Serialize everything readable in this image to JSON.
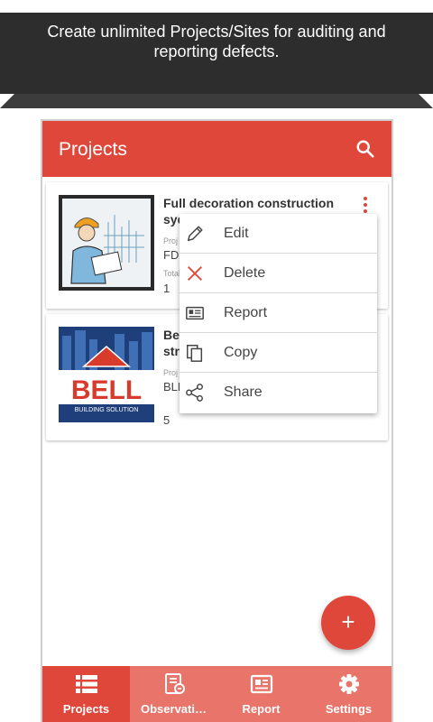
{
  "banner": {
    "text": "Create unlimited Projects/Sites for auditing and reporting defects."
  },
  "appbar": {
    "title": "Projects",
    "search_icon": "search-icon"
  },
  "projects": [
    {
      "title": "Full decoration construction sydney location",
      "label_code": "Proj",
      "code": "FDC",
      "label_total": "Total",
      "count": "1"
    },
    {
      "title": "Bell",
      "title_line2": "stre",
      "label_code": "Proj",
      "code": "BLL",
      "label_total": "",
      "count": "5",
      "logo_text": "BELL",
      "logo_sub": "BUILDING SOLUTION"
    }
  ],
  "popup_menu": [
    {
      "label": "Edit",
      "icon": "pencil-icon"
    },
    {
      "label": "Delete",
      "icon": "close-icon"
    },
    {
      "label": "Report",
      "icon": "report-icon"
    },
    {
      "label": "Copy",
      "icon": "copy-icon"
    },
    {
      "label": "Share",
      "icon": "share-icon"
    }
  ],
  "fab": {
    "label": "+",
    "icon": "add-icon"
  },
  "bottom_nav": [
    {
      "label": "Projects",
      "icon": "list-icon",
      "active": true
    },
    {
      "label": "Observati…",
      "icon": "observation-icon",
      "active": false
    },
    {
      "label": "Report",
      "icon": "report-icon",
      "active": false
    },
    {
      "label": "Settings",
      "icon": "gear-icon",
      "active": false
    }
  ],
  "colors": {
    "primary": "#e0473b",
    "nav_inactive": "#e8746a",
    "banner_bg": "#2d2d2d"
  }
}
